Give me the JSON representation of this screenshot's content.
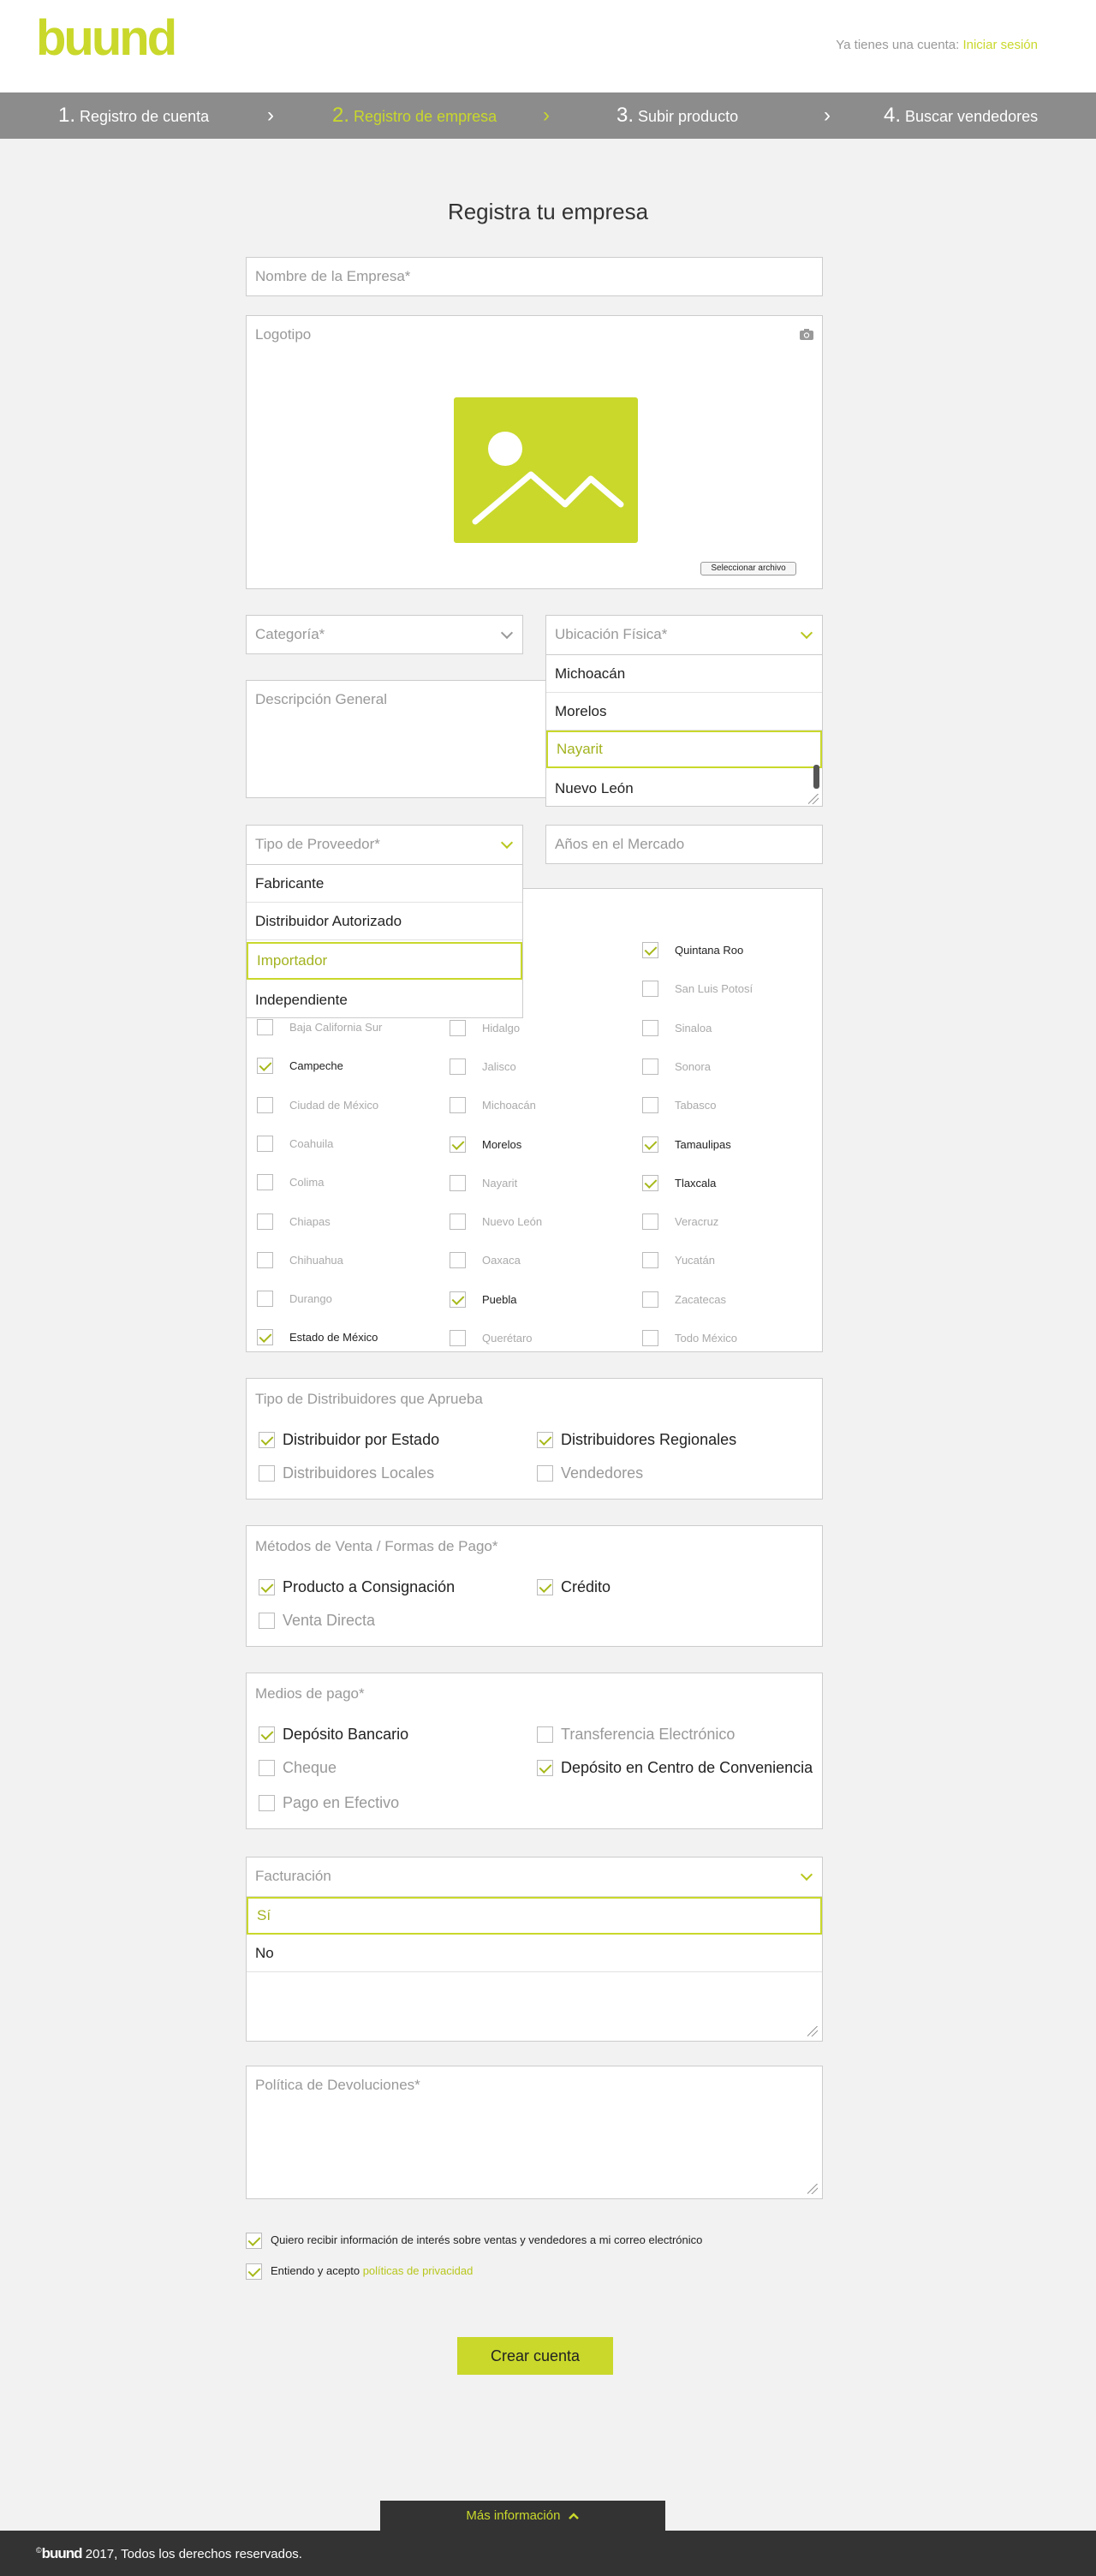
{
  "header": {
    "logo_text": "buund",
    "login_prompt": "Ya tienes una cuenta:",
    "login_link": "Iniciar sesión"
  },
  "steps": [
    {
      "num": "1.",
      "label": "Registro de cuenta"
    },
    {
      "num": "2.",
      "label": "Registro de empresa"
    },
    {
      "num": "3.",
      "label": "Subir producto"
    },
    {
      "num": "4.",
      "label": "Buscar vendedores"
    }
  ],
  "page_title": "Registra tu empresa",
  "form": {
    "company_name_placeholder": "Nombre de la Empresa*",
    "logo_label": "Logotipo",
    "logo_button": "Seleccionar archivo",
    "category_placeholder": "Categoría*",
    "location_placeholder": "Ubicación Física*",
    "location_options": [
      "Michoacán",
      "Morelos",
      "Nayarit",
      "Nuevo León"
    ],
    "location_selected": "Nayarit",
    "description_placeholder": "Descripción General",
    "provider_type_placeholder": "Tipo de Proveedor*",
    "provider_options": [
      "Fabricante",
      "Distribuidor Autorizado",
      "Importador",
      "Independiente"
    ],
    "provider_selected": "Importador",
    "years_placeholder": "Años en el Mercado",
    "states": {
      "col1": [
        {
          "name": "Baja California Sur",
          "checked": false
        },
        {
          "name": "Campeche",
          "checked": true
        },
        {
          "name": "Ciudad de México",
          "checked": false
        },
        {
          "name": "Coahuila",
          "checked": false
        },
        {
          "name": "Colima",
          "checked": false
        },
        {
          "name": "Chiapas",
          "checked": false
        },
        {
          "name": "Chihuahua",
          "checked": false
        },
        {
          "name": "Durango",
          "checked": false
        },
        {
          "name": "Estado de México",
          "checked": true
        }
      ],
      "col2": [
        {
          "name": "uato",
          "checked": false
        },
        {
          "name": "o",
          "checked": false
        },
        {
          "name": "Hidalgo",
          "checked": false
        },
        {
          "name": "Jalisco",
          "checked": false
        },
        {
          "name": "Michoacán",
          "checked": false
        },
        {
          "name": "Morelos",
          "checked": true
        },
        {
          "name": "Nayarit",
          "checked": false
        },
        {
          "name": "Nuevo León",
          "checked": false
        },
        {
          "name": "Oaxaca",
          "checked": false
        },
        {
          "name": "Puebla",
          "checked": true
        },
        {
          "name": "Querétaro",
          "checked": false
        }
      ],
      "col3": [
        {
          "name": "Quintana Roo",
          "checked": true
        },
        {
          "name": "San Luis Potosí",
          "checked": false
        },
        {
          "name": "Sinaloa",
          "checked": false
        },
        {
          "name": "Sonora",
          "checked": false
        },
        {
          "name": "Tabasco",
          "checked": false
        },
        {
          "name": "Tamaulipas",
          "checked": true
        },
        {
          "name": "Tlaxcala",
          "checked": true
        },
        {
          "name": "Veracruz",
          "checked": false
        },
        {
          "name": "Yucatán",
          "checked": false
        },
        {
          "name": "Zacatecas",
          "checked": false
        },
        {
          "name": "Todo México",
          "checked": false
        }
      ]
    },
    "distributors": {
      "title": "Tipo de Distribuidores que Aprueba",
      "items": [
        {
          "label": "Distribuidor por Estado",
          "checked": true
        },
        {
          "label": "Distribuidores Regionales",
          "checked": true
        },
        {
          "label": "Distribuidores Locales",
          "checked": false
        },
        {
          "label": "Vendedores",
          "checked": false
        }
      ]
    },
    "sales": {
      "title": "Métodos de Venta / Formas de Pago*",
      "items": [
        {
          "label": "Producto a Consignación",
          "checked": true
        },
        {
          "label": "Crédito",
          "checked": true
        },
        {
          "label": "Venta Directa",
          "checked": false
        }
      ]
    },
    "payment": {
      "title": "Medios de pago*",
      "items": [
        {
          "label": "Depósito Bancario",
          "checked": true
        },
        {
          "label": "Transferencia Electrónico",
          "checked": false
        },
        {
          "label": "Cheque",
          "checked": false
        },
        {
          "label": "Depósito en Centro de Conveniencia",
          "checked": true
        },
        {
          "label": "Pago en Efectivo",
          "checked": false
        }
      ]
    },
    "billing": {
      "placeholder": "Facturación",
      "options": [
        "Sí",
        "No"
      ],
      "selected": "Sí"
    },
    "returns_placeholder": "Política de Devoluciones*",
    "consent1": "Quiero recibir información de interés sobre ventas y vendedores a mi correo electrónico",
    "consent2_text": "Entiendo y acepto",
    "consent2_link": "políticas de privacidad",
    "submit": "Crear cuenta"
  },
  "footer": {
    "more_info": "Más información",
    "copyright_logo": "buund",
    "copyright_text": "2017, Todos los derechos reservados."
  },
  "colors": {
    "accent": "#c9d82b",
    "dark": "#333333",
    "steps_bar": "#8c8c8c"
  }
}
